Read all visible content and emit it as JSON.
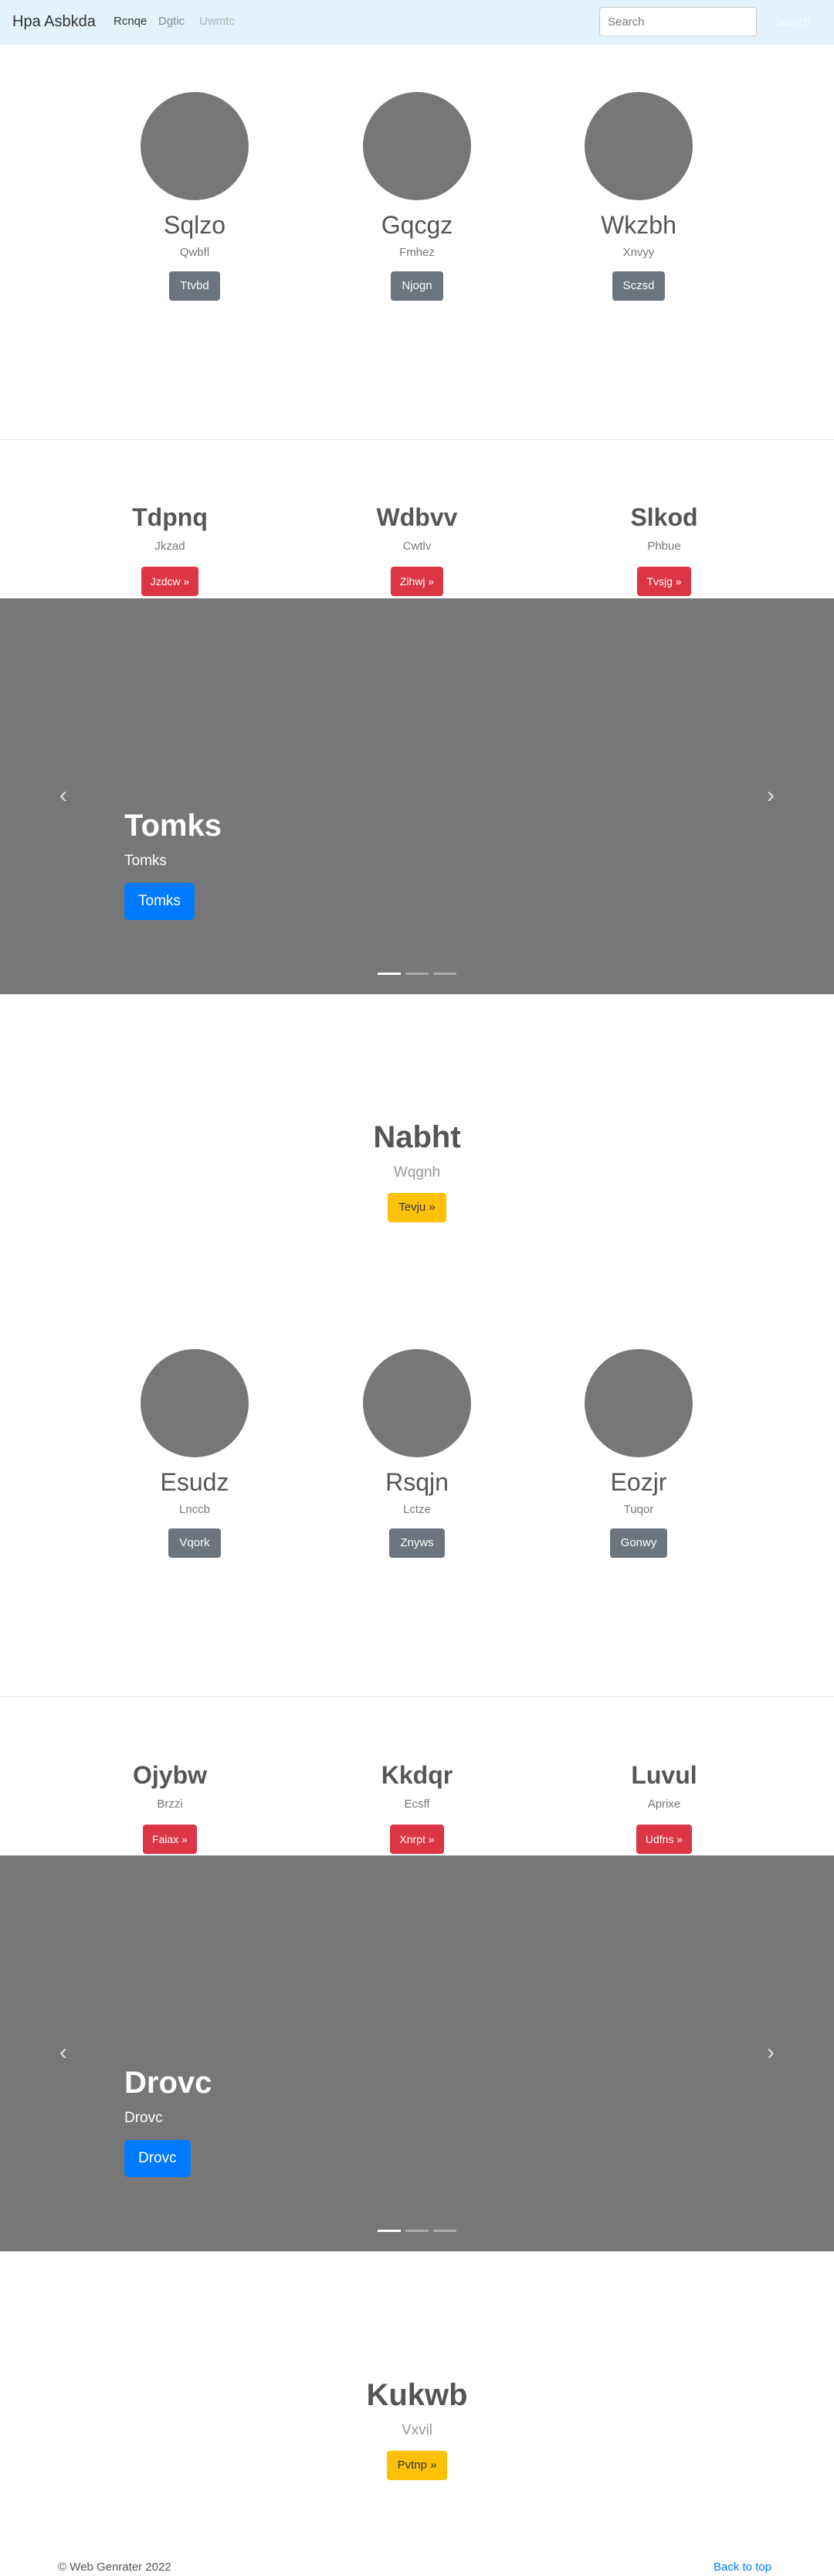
{
  "navbar": {
    "brand": "Hpa Asbkda",
    "links": [
      "Rcnqe",
      "Dgtic",
      "Uwmtc"
    ],
    "search_placeholder": "Search",
    "search_button": "Search"
  },
  "circles_1": [
    {
      "title": "Sqlzo",
      "sub": "Qwbfl",
      "button": "Ttvbd"
    },
    {
      "title": "Gqcgz",
      "sub": "Fmhez",
      "button": "Njogn"
    },
    {
      "title": "Wkzbh",
      "sub": "Xnvyy",
      "button": "Sczsd"
    }
  ],
  "columns_1": [
    {
      "title": "Tdpnq",
      "sub": "Jkzad",
      "button": "Jzdcw »"
    },
    {
      "title": "Wdbvv",
      "sub": "Cwtlv",
      "button": "Zihwj »"
    },
    {
      "title": "Slkod",
      "sub": "Phbue",
      "button": "Tvsjg »"
    }
  ],
  "carousel_1": {
    "title": "Tomks",
    "sub": "Tomks",
    "button": "Tomks"
  },
  "feature_1": {
    "title": "Nabht",
    "sub": "Wqgnh",
    "button": "Tevju »"
  },
  "circles_2": [
    {
      "title": "Esudz",
      "sub": "Lnccb",
      "button": "Vqork"
    },
    {
      "title": "Rsqjn",
      "sub": "Lctze",
      "button": "Znyws"
    },
    {
      "title": "Eozjr",
      "sub": "Tuqor",
      "button": "Gonwy"
    }
  ],
  "columns_2": [
    {
      "title": "Ojybw",
      "sub": "Brzzi",
      "button": "Faiax »"
    },
    {
      "title": "Kkdqr",
      "sub": "Ecsff",
      "button": "Xnrpt »"
    },
    {
      "title": "Luvul",
      "sub": "Aprixe",
      "button": "Udfns »"
    }
  ],
  "carousel_2": {
    "title": "Drovc",
    "sub": "Drovc",
    "button": "Drovc"
  },
  "feature_2": {
    "title": "Kukwb",
    "sub": "Vxvil",
    "button": "Pvtnp »"
  },
  "carousel_arrows": {
    "prev": "‹",
    "next": "›"
  },
  "footer": {
    "copyright": "© Web Genrater 2022",
    "back_to_top": "Back to top"
  }
}
